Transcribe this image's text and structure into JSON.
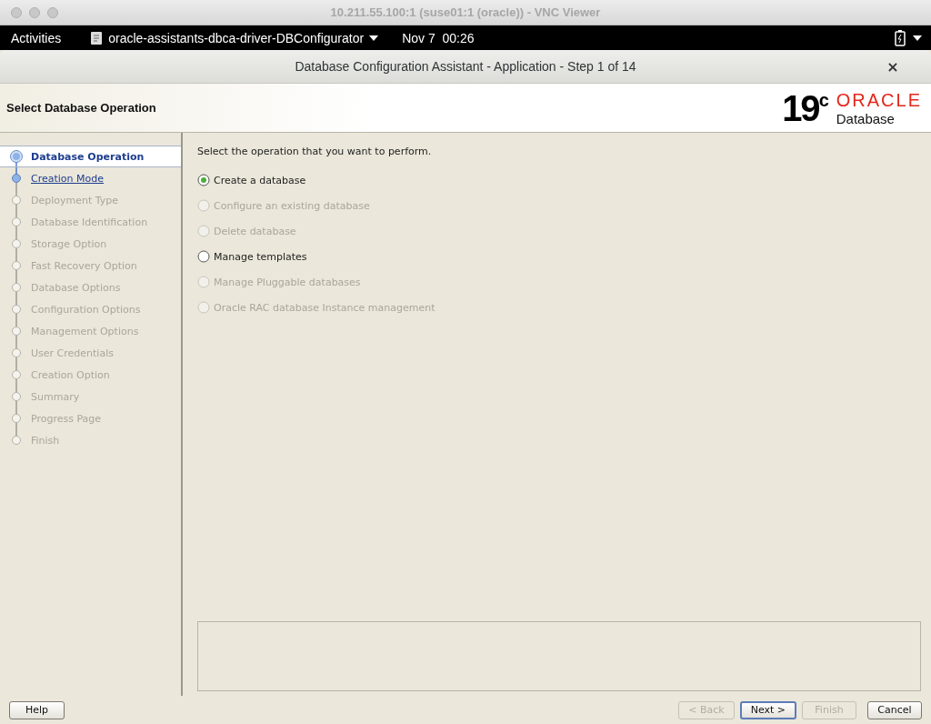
{
  "viewer_window": {
    "title": "10.211.55.100:1 (suse01:1 (oracle)) - VNC Viewer"
  },
  "top_bar": {
    "activities": "Activities",
    "app_menu": "oracle-assistants-dbca-driver-DBConfigurator",
    "clock": "Nov 7  00:26"
  },
  "dialog": {
    "title": "Database Configuration Assistant - Application - Step 1 of 14",
    "close": "×"
  },
  "header": {
    "title": "Select Database Operation",
    "version": "19",
    "version_sup": "c",
    "brand": "ORACLE",
    "product": "Database"
  },
  "steps": [
    {
      "label": "Database Operation",
      "selected": true,
      "disabled": false
    },
    {
      "label": "Creation Mode",
      "selected": false,
      "disabled": false
    },
    {
      "label": "Deployment Type",
      "selected": false,
      "disabled": true
    },
    {
      "label": "Database Identification",
      "selected": false,
      "disabled": true
    },
    {
      "label": "Storage Option",
      "selected": false,
      "disabled": true
    },
    {
      "label": "Fast Recovery Option",
      "selected": false,
      "disabled": true
    },
    {
      "label": "Database Options",
      "selected": false,
      "disabled": true
    },
    {
      "label": "Configuration Options",
      "selected": false,
      "disabled": true
    },
    {
      "label": "Management Options",
      "selected": false,
      "disabled": true
    },
    {
      "label": "User Credentials",
      "selected": false,
      "disabled": true
    },
    {
      "label": "Creation Option",
      "selected": false,
      "disabled": true
    },
    {
      "label": "Summary",
      "selected": false,
      "disabled": true
    },
    {
      "label": "Progress Page",
      "selected": false,
      "disabled": true
    },
    {
      "label": "Finish",
      "selected": false,
      "disabled": true
    }
  ],
  "prompt": "Select the operation that you want to perform.",
  "options": [
    {
      "label": "Create a database",
      "selected": true,
      "disabled": false
    },
    {
      "label": "Configure an existing database",
      "selected": false,
      "disabled": true
    },
    {
      "label": "Delete database",
      "selected": false,
      "disabled": true
    },
    {
      "label": "Manage templates",
      "selected": false,
      "disabled": false
    },
    {
      "label": "Manage Pluggable databases",
      "selected": false,
      "disabled": true
    },
    {
      "label": "Oracle RAC database Instance management",
      "selected": false,
      "disabled": true
    }
  ],
  "buttons": [
    {
      "label": "Help",
      "kind": "help",
      "disabled": false,
      "default": false
    },
    {
      "label": "< Back",
      "kind": "nav",
      "disabled": true,
      "default": false
    },
    {
      "label": "Next >",
      "kind": "nav",
      "disabled": false,
      "default": true
    },
    {
      "label": "Finish",
      "kind": "nav",
      "disabled": true,
      "default": false
    },
    {
      "label": "Cancel",
      "kind": "cancel",
      "disabled": false,
      "default": false
    }
  ]
}
